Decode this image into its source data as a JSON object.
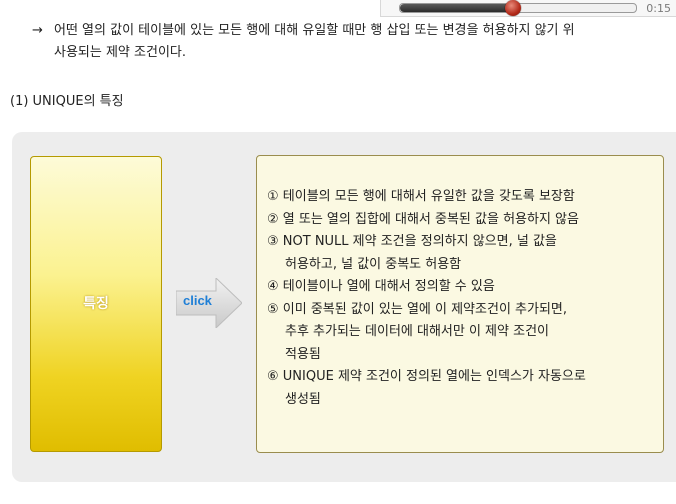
{
  "player": {
    "time": "0:15",
    "progress": 0.48
  },
  "description": {
    "arrow": "→",
    "line1": "어떤 열의 값이 테이블에 있는 모든 행에 대해 유일할 때만 행 삽입 또는 변경을 허용하지 않기 위",
    "line2": "사용되는 제약 조건이다."
  },
  "subheading": "(1) UNIQUE의 특징",
  "feature_label": "특징",
  "click_label": "click",
  "items": [
    {
      "lines": [
        "① 테이블의 모든 행에 대해서 유일한 값을 갖도록 보장함"
      ]
    },
    {
      "lines": [
        "② 열 또는 열의 집합에 대해서 중복된 값을 허용하지 않음"
      ]
    },
    {
      "lines": [
        "③ NOT NULL 제약 조건을 정의하지 않으면, 널 값을",
        "허용하고, 널 값이 중복도 허용함"
      ]
    },
    {
      "lines": [
        "④ 테이블이나 열에 대해서 정의할 수 있음"
      ]
    },
    {
      "lines": [
        "⑤ 이미 중복된 값이 있는 열에 이 제약조건이 추가되면,",
        "추후 추가되는 데이터에 대해서만 이 제약 조건이",
        "적용됨"
      ]
    },
    {
      "lines": [
        "⑥ UNIQUE 제약 조건이 정의된 열에는 인덱스가 자동으로",
        "생성됨"
      ]
    }
  ]
}
